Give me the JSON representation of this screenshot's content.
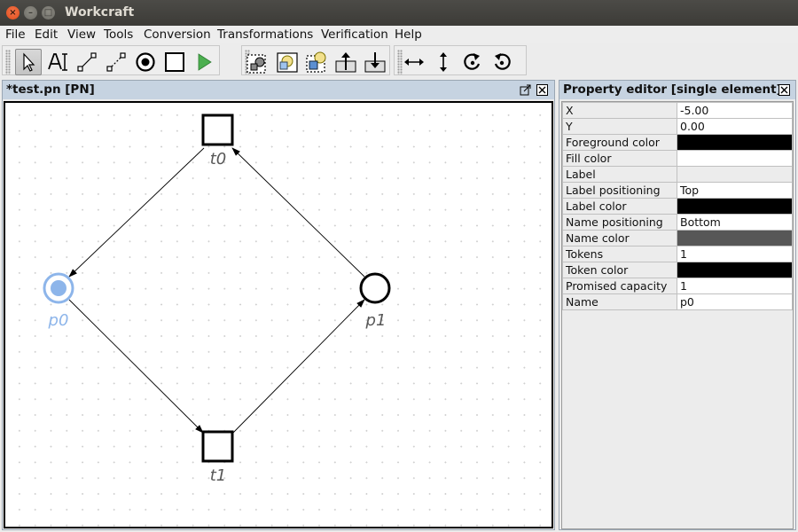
{
  "window": {
    "title": "Workcraft"
  },
  "menu": [
    "File",
    "Edit",
    "View",
    "Tools",
    "Conversion",
    "Transformations",
    "Verification",
    "Help"
  ],
  "toolbar": {
    "tools": [
      {
        "name": "select-tool",
        "icon": "cursor-icon",
        "active": true
      },
      {
        "name": "text-tool",
        "icon": "text-cursor-icon"
      },
      {
        "name": "connect-tool",
        "icon": "connect-icon"
      },
      {
        "name": "read-arc-tool",
        "icon": "read-arc-icon"
      },
      {
        "name": "place-tool",
        "icon": "place-icon"
      },
      {
        "name": "transition-tool",
        "icon": "transition-icon"
      },
      {
        "name": "simulation-tool",
        "icon": "play-icon"
      },
      {
        "name": "group-tool",
        "icon": "group-icon"
      },
      {
        "name": "page-tool",
        "icon": "page-icon"
      },
      {
        "name": "collapse-tool",
        "icon": "collapse-icon"
      },
      {
        "name": "level-up-tool",
        "icon": "level-up-icon"
      },
      {
        "name": "level-down-tool",
        "icon": "level-down-icon"
      },
      {
        "name": "flip-horizontal-tool",
        "icon": "flip-horizontal-icon"
      },
      {
        "name": "flip-vertical-tool",
        "icon": "flip-vertical-icon"
      },
      {
        "name": "rotate-clockwise-tool",
        "icon": "rotate-clockwise-icon"
      },
      {
        "name": "rotate-counterclockwise-tool",
        "icon": "rotate-counterclockwise-icon"
      }
    ],
    "simulation_color": "#4caf50"
  },
  "editor": {
    "title": "*test.pn [PN]",
    "net": {
      "transitions": [
        {
          "label": "t0"
        },
        {
          "label": "t1"
        }
      ],
      "places": [
        {
          "label": "p0",
          "tokens": 1,
          "selected": true
        },
        {
          "label": "p1",
          "tokens": 0,
          "selected": false
        }
      ],
      "selection_color": "#8db5ea"
    }
  },
  "property_editor": {
    "title": "Property editor [single element]",
    "rows": [
      {
        "name": "X",
        "value": "-5.00"
      },
      {
        "name": "Y",
        "value": "0.00"
      },
      {
        "name": "Foreground color",
        "value": "",
        "color": "#000000"
      },
      {
        "name": "Fill color",
        "value": "",
        "color": "#ffffff"
      },
      {
        "name": "Label",
        "value": ""
      },
      {
        "name": "Label positioning",
        "value": "Top"
      },
      {
        "name": "Label color",
        "value": "",
        "color": "#000000"
      },
      {
        "name": "Name positioning",
        "value": "Bottom"
      },
      {
        "name": "Name color",
        "value": "",
        "color": "#575757"
      },
      {
        "name": "Tokens",
        "value": "1"
      },
      {
        "name": "Token color",
        "value": "",
        "color": "#000000"
      },
      {
        "name": "Promised capacity",
        "value": "1"
      },
      {
        "name": "Name",
        "value": "p0"
      }
    ]
  }
}
